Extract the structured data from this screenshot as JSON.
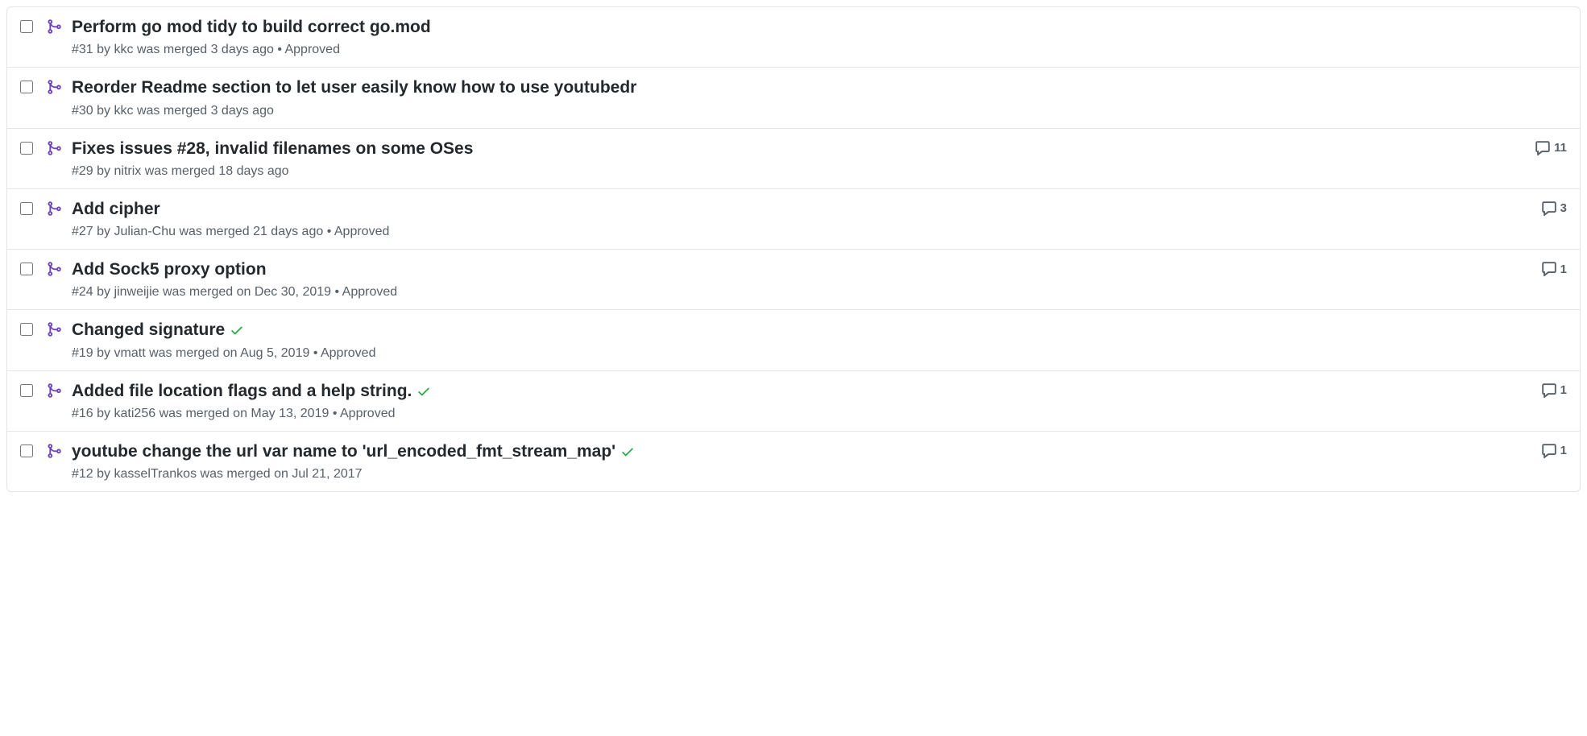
{
  "colors": {
    "merged": "#6f42c1",
    "success": "#28a745"
  },
  "pull_requests": [
    {
      "title": "Perform go mod tidy to build correct go.mod",
      "number": "#31",
      "author": "kkc",
      "merged_at": "3 days ago",
      "approved": true,
      "success_check": false,
      "comments": null
    },
    {
      "title": "Reorder Readme section to let user easily know how to use youtubedr",
      "number": "#30",
      "author": "kkc",
      "merged_at": "3 days ago",
      "approved": false,
      "success_check": false,
      "comments": null
    },
    {
      "title": "Fixes issues #28, invalid filenames on some OSes",
      "number": "#29",
      "author": "nitrix",
      "merged_at": "18 days ago",
      "approved": false,
      "success_check": false,
      "comments": 11
    },
    {
      "title": "Add cipher",
      "number": "#27",
      "author": "Julian-Chu",
      "merged_at": "21 days ago",
      "approved": true,
      "success_check": false,
      "comments": 3
    },
    {
      "title": "Add Sock5 proxy option",
      "number": "#24",
      "author": "jinweijie",
      "merged_at": "on Dec 30, 2019",
      "approved": true,
      "success_check": false,
      "comments": 1
    },
    {
      "title": "Changed signature",
      "number": "#19",
      "author": "vmatt",
      "merged_at": "on Aug 5, 2019",
      "approved": true,
      "success_check": true,
      "comments": null
    },
    {
      "title": "Added file location flags and a help string.",
      "number": "#16",
      "author": "kati256",
      "merged_at": "on May 13, 2019",
      "approved": true,
      "success_check": true,
      "comments": 1
    },
    {
      "title": "youtube change the url var name to 'url_encoded_fmt_stream_map'",
      "number": "#12",
      "author": "kasselTrankos",
      "merged_at": "on Jul 21, 2017",
      "approved": false,
      "success_check": true,
      "comments": 1
    }
  ],
  "strings": {
    "by": "by",
    "was_merged": "was merged",
    "approved": "Approved"
  }
}
